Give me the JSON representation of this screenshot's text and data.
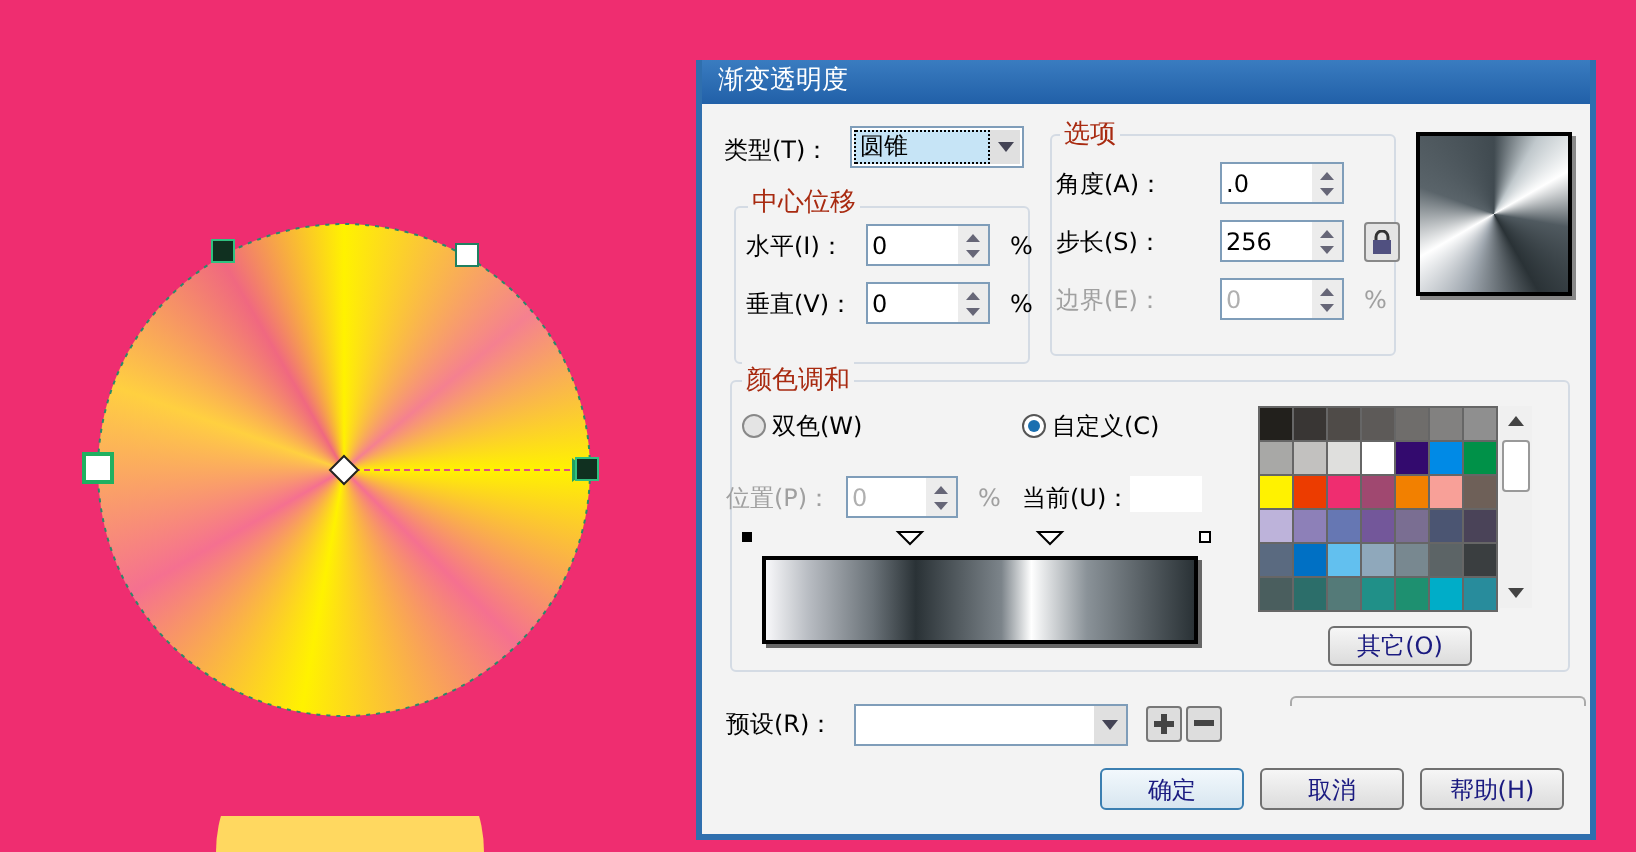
{
  "window": {
    "title": "渐变透明度"
  },
  "type_field": {
    "label": "类型(T)：",
    "value": "圆锥"
  },
  "center_offset": {
    "title": "中心位移",
    "fields": [
      {
        "label": "水平(I)：",
        "value": "0",
        "unit": "%",
        "disabled": false
      },
      {
        "label": "垂直(V)：",
        "value": "0",
        "unit": "%",
        "disabled": false
      }
    ]
  },
  "options": {
    "title": "选项",
    "fields": [
      {
        "label": "角度(A)：",
        "value": ".0",
        "disabled": false
      },
      {
        "label": "步长(S)：",
        "value": "256",
        "disabled": false,
        "locked": true
      },
      {
        "label": "边界(E)：",
        "value": "0",
        "unit": "%",
        "disabled": true
      }
    ]
  },
  "color_blend": {
    "title": "颜色调和",
    "radios": [
      {
        "label": "双色(W)",
        "selected": false
      },
      {
        "label": "自定义(C)",
        "selected": true
      }
    ],
    "position": {
      "label": "位置(P)：",
      "value": "0",
      "unit": "%",
      "disabled": true
    },
    "current": {
      "label": "当前(U)："
    },
    "palette": [
      {
        "color": "#22201c"
      },
      {
        "color": "#393634"
      },
      {
        "color": "#4f4b48"
      },
      {
        "color": "#5d5a58"
      },
      {
        "color": "#6f6d6b"
      },
      {
        "color": "#828180"
      },
      {
        "color": "#8f8f8f"
      },
      {
        "color": "#a8a8a6"
      },
      {
        "color": "#c2c1bf"
      },
      {
        "color": "#dfdfdd"
      },
      {
        "color": "#ffffff"
      },
      {
        "color": "#330a6e"
      },
      {
        "color": "#008ae6"
      },
      {
        "color": "#009148"
      },
      {
        "color": "#fff200"
      },
      {
        "color": "#ec3c00"
      },
      {
        "color": "#ef2d70"
      },
      {
        "color": "#a04870"
      },
      {
        "color": "#f28000"
      },
      {
        "color": "#f8a098"
      },
      {
        "color": "#6e6058"
      },
      {
        "color": "#bdb3da"
      },
      {
        "color": "#8d80b8"
      },
      {
        "color": "#6677b3"
      },
      {
        "color": "#73579a"
      },
      {
        "color": "#7a6e92"
      },
      {
        "color": "#4b5572"
      },
      {
        "color": "#4a4358"
      },
      {
        "color": "#5a6a80"
      },
      {
        "color": "#0070c4"
      },
      {
        "color": "#62c0ef"
      },
      {
        "color": "#8fa8bb"
      },
      {
        "color": "#788890"
      },
      {
        "color": "#5c6466"
      },
      {
        "color": "#3a3e40"
      },
      {
        "color": "#4a5e5e"
      },
      {
        "color": "#2c6e6a"
      },
      {
        "color": "#547a78"
      },
      {
        "color": "#209088"
      },
      {
        "color": "#1e9070"
      },
      {
        "color": "#00adc8"
      },
      {
        "color": "#288c9c"
      }
    ],
    "other_button": "其它(O)"
  },
  "presets": {
    "label": "预设(R)："
  },
  "buttons": [
    "确定",
    "取消",
    "帮助(H)"
  ]
}
